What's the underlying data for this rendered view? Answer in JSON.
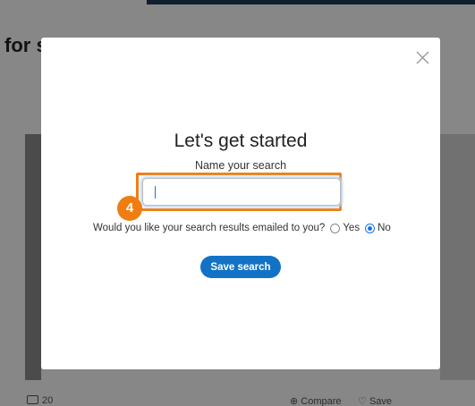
{
  "background": {
    "page_title_fragment": "for s",
    "photo_count": "20",
    "compare_label": "Compare",
    "save_label": "Save"
  },
  "modal": {
    "heading": "Let's get started",
    "name_label": "Name your search",
    "name_input": {
      "value": "",
      "placeholder": ""
    },
    "step_badge": "4",
    "email_question": "Would you like your search results emailed to you?",
    "email_options": [
      {
        "label": "Yes",
        "checked": false
      },
      {
        "label": "No",
        "checked": true
      }
    ],
    "save_button": "Save search",
    "close_icon": "close-icon"
  },
  "colors": {
    "highlight": "#f07d12",
    "primary": "#1273c6",
    "overlay": "rgba(0,0,0,0.47)"
  }
}
